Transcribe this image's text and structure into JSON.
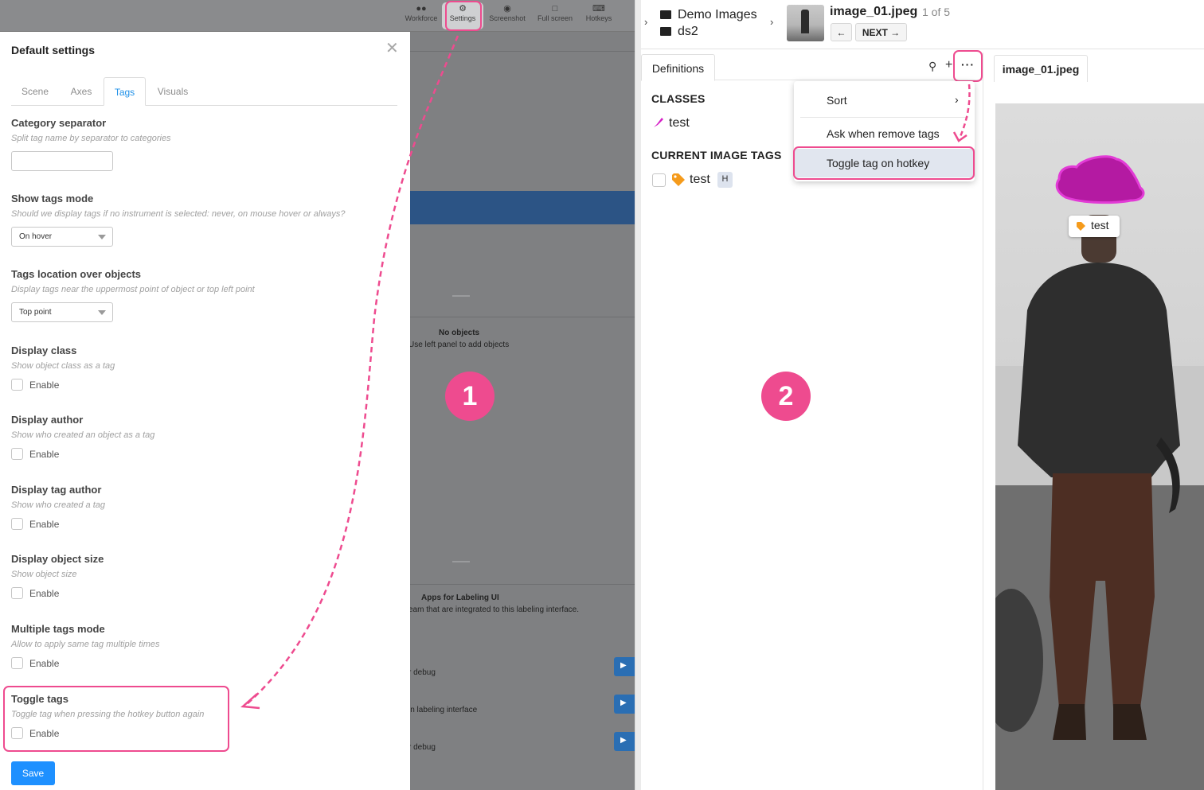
{
  "toolbar": {
    "items": [
      {
        "label": "Workforce",
        "icon": "people-icon"
      },
      {
        "label": "Settings",
        "icon": "gear-icon"
      },
      {
        "label": "Screenshot",
        "icon": "camera-icon"
      },
      {
        "label": "Full screen",
        "icon": "fullscreen-icon"
      },
      {
        "label": "Hotkeys",
        "icon": "keyboard-icon"
      }
    ]
  },
  "background": {
    "no_objects_title": "No objects",
    "no_objects_hint": "Use left panel to add objects",
    "apps_title": "Apps for Labeling UI",
    "apps_hint": "eam that are integrated to this labeling interface.",
    "row1": "r debug",
    "row2": " in labeling interface",
    "row3": "r debug"
  },
  "modal": {
    "title": "Default settings",
    "tabs": [
      "Scene",
      "Axes",
      "Tags",
      "Visuals"
    ],
    "active_tab": "Tags",
    "category_separator": {
      "label": "Category separator",
      "desc": "Split tag name by separator to categories",
      "value": ""
    },
    "show_tags_mode": {
      "label": "Show tags mode",
      "desc": "Should we display tags if no instrument is selected: never, on mouse hover or always?",
      "value": "On hover"
    },
    "tags_location": {
      "label": "Tags location over objects",
      "desc": "Display tags near the uppermost point of object or top left point",
      "value": "Top point"
    },
    "checkbox_sections": [
      {
        "label": "Display class",
        "desc": "Show object class as a tag",
        "option": "Enable",
        "checked": false
      },
      {
        "label": "Display author",
        "desc": "Show who created an object as a tag",
        "option": "Enable",
        "checked": false
      },
      {
        "label": "Display tag author",
        "desc": "Show who created a tag",
        "option": "Enable",
        "checked": false
      },
      {
        "label": "Display object size",
        "desc": "Show object size",
        "option": "Enable",
        "checked": false
      },
      {
        "label": "Multiple tags mode",
        "desc": "Allow to apply same tag multiple times",
        "option": "Enable",
        "checked": false
      },
      {
        "label": "Toggle tags",
        "desc": "Toggle tag when pressing the hotkey button again",
        "option": "Enable",
        "checked": false
      }
    ],
    "save_label": "Save"
  },
  "steps": [
    "1",
    "2"
  ],
  "right": {
    "dataset": {
      "project": "Demo Images",
      "dataset": "ds2"
    },
    "image_name": "image_01.jpeg",
    "counter": "1 of 5",
    "prev_label": "←",
    "next_label": "NEXT →",
    "definitions_tab": "Definitions",
    "classes_header": "CLASSES",
    "class_name": "test",
    "image_tags_header": "CURRENT IMAGE TAGS",
    "tag_name": "test",
    "tag_hotkey": "H",
    "menu": {
      "sort": "Sort",
      "ask_remove": "Ask when remove tags",
      "toggle": "Toggle tag on hotkey"
    },
    "image_tab": "image_01.jpeg",
    "image_tag_label": "test"
  },
  "colors": {
    "highlight": "#ee4b8f",
    "accent": "#1e90ff",
    "hat": "#c41ab4",
    "tag_icon": "#f59b1c"
  }
}
